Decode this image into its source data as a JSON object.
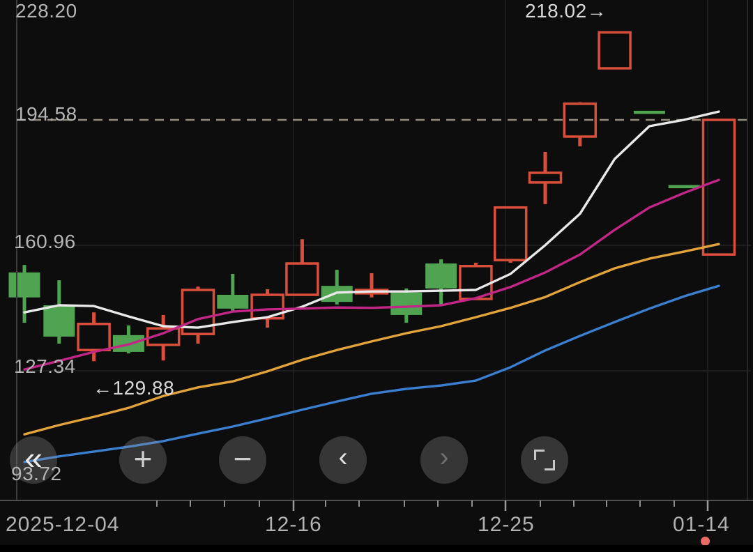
{
  "y_axis": {
    "labels": [
      "228.20",
      "194.58",
      "160.96",
      "127.34",
      "93.72"
    ]
  },
  "x_axis": {
    "labels": [
      "2025-12-04",
      "12-16",
      "12-25",
      "01-14"
    ]
  },
  "annotations": {
    "high_marker": "218.02→",
    "low_marker": "←129.88"
  },
  "colors": {
    "background": "#0d0d0d",
    "up": "#d94f3b",
    "down": "#4fa351",
    "dashed_price_line": "#918c7e",
    "axis_text": "#b4b4b4",
    "live_dot": "#ea6b66"
  },
  "chart_data": {
    "type": "candlestick",
    "title": "",
    "xlabel": "",
    "ylabel": "",
    "y_ticks": [
      228.2,
      194.58,
      160.96,
      127.34,
      93.72
    ],
    "x_tick_labels": [
      "2025-12-04",
      "12-16",
      "12-25",
      "01-14"
    ],
    "price_line_value": 194.58,
    "high_annotation": 218.02,
    "low_annotation": 129.88,
    "up_style": "hollow-red",
    "down_style": "filled-green",
    "candles": [
      {
        "o": 153.7,
        "h": 155.7,
        "l": 140.2,
        "c": 147.0
      },
      {
        "o": 144.9,
        "h": 151.6,
        "l": 134.6,
        "c": 136.5
      },
      {
        "o": 132.9,
        "h": 143.0,
        "l": 129.9,
        "c": 139.9
      },
      {
        "o": 136.9,
        "h": 139.5,
        "l": 132.0,
        "c": 132.4
      },
      {
        "o": 134.3,
        "h": 142.3,
        "l": 130.1,
        "c": 138.7
      },
      {
        "o": 137.2,
        "h": 149.9,
        "l": 134.6,
        "c": 149.0
      },
      {
        "o": 147.7,
        "h": 153.3,
        "l": 143.0,
        "c": 144.0
      },
      {
        "o": 141.4,
        "h": 149.2,
        "l": 138.9,
        "c": 147.7
      },
      {
        "o": 147.7,
        "h": 162.6,
        "l": 147.7,
        "c": 156.1
      },
      {
        "o": 150.1,
        "h": 154.4,
        "l": 145.1,
        "c": 145.8
      },
      {
        "o": 148.1,
        "h": 153.5,
        "l": 147.0,
        "c": 149.0
      },
      {
        "o": 148.3,
        "h": 149.4,
        "l": 140.2,
        "c": 142.3,
        "flat": false
      },
      {
        "o": 156.1,
        "h": 157.2,
        "l": 145.1,
        "c": 149.4
      },
      {
        "o": 146.6,
        "h": 156.3,
        "l": 146.6,
        "c": 155.4
      },
      {
        "o": 157.0,
        "h": 171.4,
        "l": 156.3,
        "c": 171.1
      },
      {
        "o": 177.8,
        "h": 186.0,
        "l": 172.0,
        "c": 180.4
      },
      {
        "o": 190.1,
        "h": 199.3,
        "l": 187.5,
        "c": 198.9
      },
      {
        "o": 208.4,
        "h": 218.02,
        "l": 208.4,
        "c": 218.02
      },
      {
        "o": 196.6,
        "h": 196.6,
        "l": 196.6,
        "c": 196.6,
        "flat": true
      },
      {
        "o": 176.7,
        "h": 176.7,
        "l": 176.7,
        "c": 176.7,
        "flat": true
      },
      {
        "o": 158.5,
        "h": 194.58,
        "l": 158.5,
        "c": 194.58
      }
    ],
    "ma_lines": [
      {
        "name": "ma-blue",
        "color": "#3b7fd0",
        "values": [
          102.9,
          104.4,
          105.7,
          107.0,
          108.5,
          110.5,
          112.4,
          114.6,
          116.9,
          119.1,
          121.2,
          122.5,
          123.4,
          124.7,
          128.3,
          132.8,
          136.7,
          140.4,
          144.0,
          147.3,
          150.1
        ]
      },
      {
        "name": "ma-orange",
        "color": "#e2a33b",
        "values": [
          110.3,
          112.8,
          115.0,
          117.4,
          120.6,
          122.9,
          124.5,
          127.2,
          130.3,
          132.9,
          135.2,
          137.4,
          139.3,
          141.7,
          144.2,
          147.1,
          151.1,
          154.8,
          157.4,
          159.3,
          161.3
        ]
      },
      {
        "name": "ma-white",
        "color": "#e9e9e9",
        "values": [
          143.0,
          144.9,
          144.7,
          141.9,
          139.3,
          138.9,
          140.4,
          141.7,
          144.5,
          148.3,
          148.6,
          148.6,
          148.8,
          149.0,
          153.3,
          161.0,
          169.4,
          184.1,
          192.9,
          194.6,
          196.8
        ]
      },
      {
        "name": "ma-magenta",
        "color": "#c22687",
        "values": [
          127.7,
          130.0,
          132.4,
          134.4,
          137.4,
          141.2,
          143.2,
          143.8,
          144.0,
          144.3,
          144.2,
          144.5,
          144.9,
          146.8,
          149.8,
          153.7,
          158.5,
          165.1,
          171.1,
          175.0,
          178.5
        ]
      }
    ]
  },
  "toolbar": {
    "buttons": [
      {
        "name": "rewind",
        "glyph": "«"
      },
      {
        "name": "zoom-in",
        "glyph": "+"
      },
      {
        "name": "zoom-out",
        "glyph": "−"
      },
      {
        "name": "prev",
        "glyph": "‹"
      },
      {
        "name": "next",
        "glyph": "›"
      },
      {
        "name": "fullscreen",
        "glyph": ""
      }
    ]
  }
}
